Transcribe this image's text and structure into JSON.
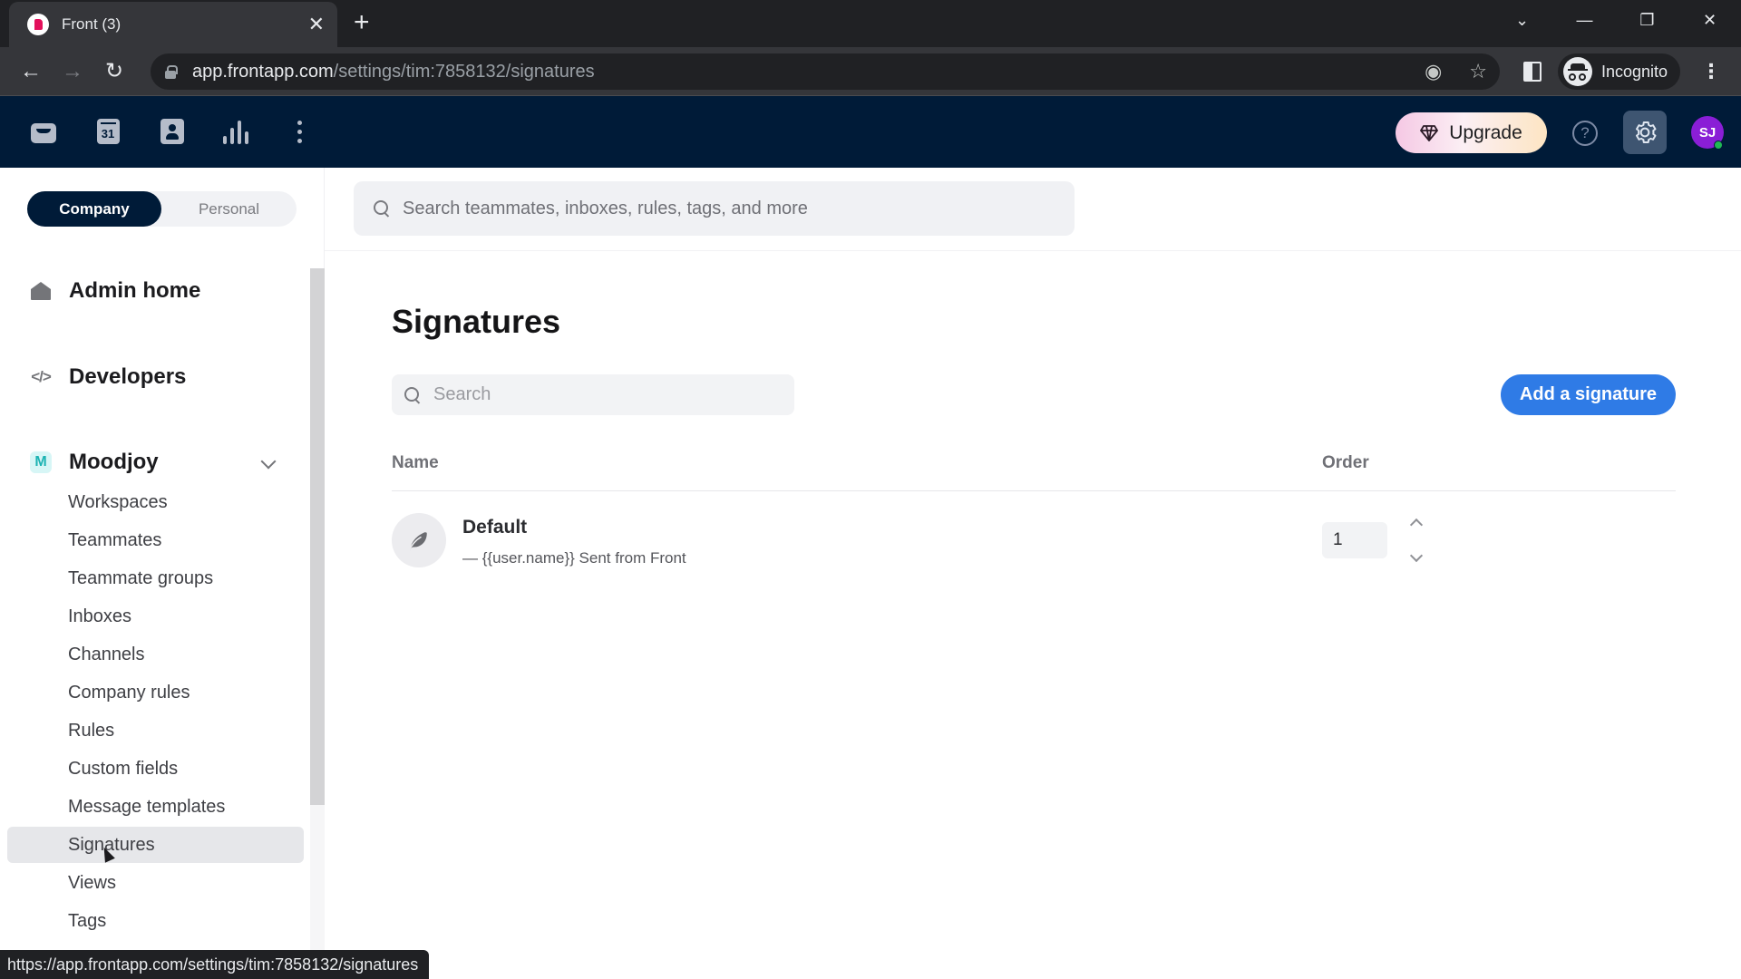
{
  "browser": {
    "tab_title": "Front (3)",
    "url_host": "app.frontapp.com",
    "url_path": "/settings/tim:7858132/signatures",
    "profile_label": "Incognito",
    "status_url": "https://app.frontapp.com/settings/tim:7858132/signatures"
  },
  "appbar": {
    "nav_icons": [
      "inbox-icon",
      "calendar-icon",
      "contacts-icon",
      "analytics-icon",
      "more-icon"
    ],
    "calendar_day": "31",
    "upgrade_label": "Upgrade",
    "help_label": "?",
    "avatar_initials": "SJ",
    "colors": {
      "header_bg": "#001b38",
      "avatar_bg": "#8a1ed6",
      "presence": "#20b954"
    }
  },
  "sidebar": {
    "scope": {
      "company": "Company",
      "personal": "Personal",
      "selected": "Company"
    },
    "sections": [
      {
        "label": "Admin home",
        "icon": "home-icon"
      },
      {
        "label": "Developers",
        "icon": "code-icon",
        "icon_text": "</>"
      },
      {
        "label": "Moodjoy",
        "icon": "workspace-badge-icon",
        "icon_text": "M",
        "expanded": true
      }
    ],
    "items": [
      {
        "label": "Workspaces"
      },
      {
        "label": "Teammates"
      },
      {
        "label": "Teammate groups"
      },
      {
        "label": "Inboxes"
      },
      {
        "label": "Channels"
      },
      {
        "label": "Company rules"
      },
      {
        "label": "Rules"
      },
      {
        "label": "Custom fields"
      },
      {
        "label": "Message templates"
      },
      {
        "label": "Signatures",
        "active": true
      },
      {
        "label": "Views"
      },
      {
        "label": "Tags"
      }
    ]
  },
  "main": {
    "global_search_placeholder": "Search teammates, inboxes, rules, tags, and more",
    "title": "Signatures",
    "search_placeholder": "Search",
    "add_button_label": "Add a signature",
    "columns": {
      "name": "Name",
      "order": "Order"
    },
    "signatures": [
      {
        "name": "Default",
        "preview": "— {{user.name}} Sent from Front",
        "order": "1"
      }
    ],
    "colors": {
      "primary": "#2f7be6"
    }
  }
}
